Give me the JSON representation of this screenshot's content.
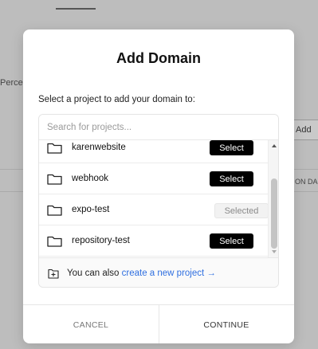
{
  "background": {
    "left_text": "Perce",
    "add_button_label": "Add",
    "column_text": "ON DA"
  },
  "modal": {
    "title": "Add Domain",
    "subtitle": "Select a project to add your domain to:",
    "search": {
      "placeholder": "Search for projects...",
      "value": ""
    },
    "projects": [
      {
        "name": "karenwebsite",
        "action": "Select"
      },
      {
        "name": "webhook",
        "action": "Select"
      },
      {
        "name": "expo-test",
        "action": "Selected"
      },
      {
        "name": "repository-test",
        "action": "Select"
      }
    ],
    "create_prefix": "You can also ",
    "create_link": "create a new project →",
    "cancel_label": "CANCEL",
    "continue_label": "CONTINUE"
  },
  "icons": {
    "folder": "folder-icon",
    "new_folder": "folder-plus-icon"
  },
  "colors": {
    "accent_link": "#2f6fe0",
    "select_button": "#000000",
    "selected_badge": "#f2f2f2",
    "overlay": "#bdbdbd"
  }
}
